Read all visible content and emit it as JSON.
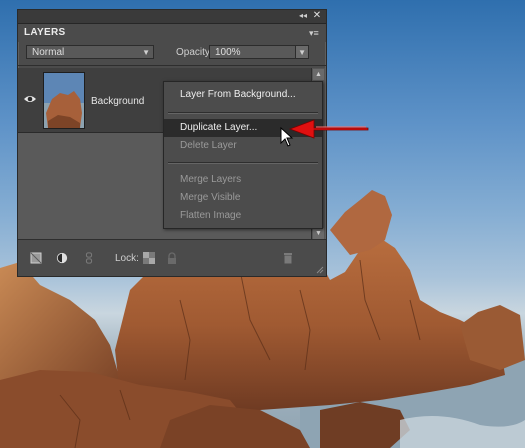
{
  "panel": {
    "title": "LAYERS",
    "blend_mode": "Normal",
    "opacity_label": "Opacity:",
    "opacity_value": "100%",
    "lock_label": "Lock:",
    "layers": [
      {
        "name": "Background",
        "visible": true
      }
    ]
  },
  "context_menu": {
    "items": [
      {
        "label": "Layer From Background...",
        "enabled": true
      },
      {
        "label": "Duplicate Layer...",
        "enabled": true,
        "highlighted": true
      },
      {
        "label": "Delete Layer",
        "enabled": false
      },
      {
        "label": "Merge Layers",
        "enabled": false
      },
      {
        "label": "Merge Visible",
        "enabled": false
      },
      {
        "label": "Flatten Image",
        "enabled": false
      }
    ]
  },
  "colors": {
    "panel_bg": "#4b4b4b",
    "highlight": "#2b2b2b",
    "callout_arrow": "#e01010"
  }
}
